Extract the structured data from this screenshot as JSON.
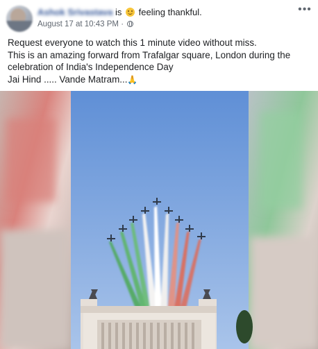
{
  "header": {
    "author_name": "Ashok Srivastava",
    "is_text": "is",
    "feeling_text": "feeling thankful.",
    "feeling_icon": "smiley-icon",
    "timestamp": "August 17 at 10:43 PM",
    "separator": "·",
    "privacy_icon": "globe-icon",
    "more_label": "•••"
  },
  "post": {
    "lines": [
      "Request everyone to watch this 1 minute video without miss.",
      "This is an amazing forward from Trafalgar square, London during the",
      "celebration of India's Independence Day",
      "Jai Hind ..... Vande Matram..."
    ],
    "end_icon": "folded-hands-icon"
  },
  "media": {
    "type": "video",
    "colors": {
      "sky": "#7fa6de",
      "trail_saffron": "#e06a55",
      "trail_white": "#f4f3f2",
      "trail_green": "#4faa5b",
      "building": "#e8e2dc"
    }
  }
}
